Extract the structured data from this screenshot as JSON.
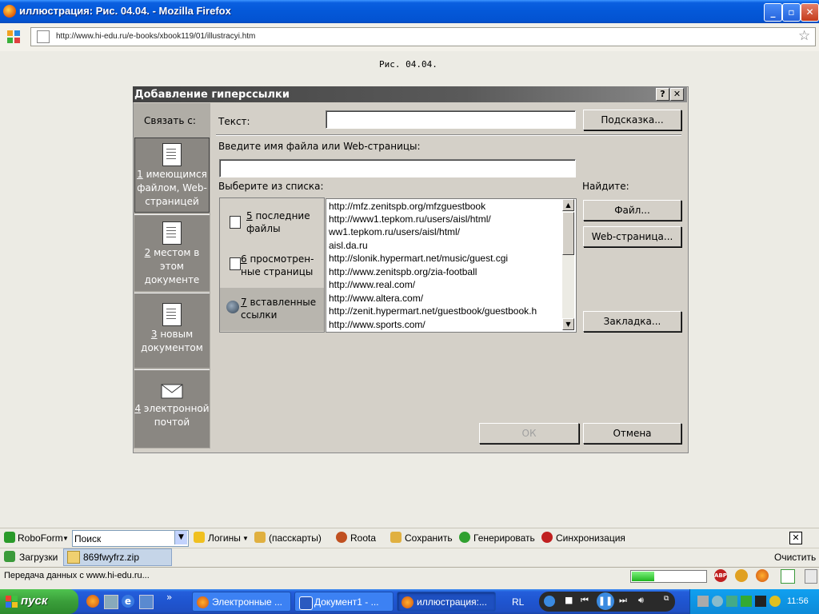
{
  "window": {
    "title": "иллюстрация: Рис. 04.04. - Mozilla Firefox",
    "min": "_",
    "max": "▫",
    "close": "✕"
  },
  "nav": {
    "url": "http://www.hi-edu.ru/e-books/xbook119/01/illustracyi.htm"
  },
  "page": {
    "caption": "Рис. 04.04."
  },
  "dialog": {
    "title": "Добавление гиперссылки",
    "help": "?",
    "close": "✕",
    "link_with": "Связать с:",
    "sidebar": [
      {
        "num": "1",
        "label1": " имеющимся",
        "label2": "файлом, Web-",
        "label3": "страницей"
      },
      {
        "num": "2",
        "label1": " местом в",
        "label2": "этом",
        "label3": "документе"
      },
      {
        "num": "3",
        "label1": " новым",
        "label2": "документом",
        "label3": ""
      },
      {
        "num": "4",
        "label1": " электронной",
        "label2": "почтой",
        "label3": ""
      }
    ],
    "text_label": "Текст:",
    "text_value": "",
    "hint_button": "Подсказка...",
    "file_label": "Введите имя файла или Web-страницы:",
    "file_value": "",
    "choose_label": "Выберите из списка:",
    "find_label": "Найдите:",
    "list_tabs": [
      {
        "num": "5",
        "line1": " последние",
        "line2": "файлы"
      },
      {
        "num": "6",
        "line1": " просмотрен-",
        "line2": "ные страницы"
      },
      {
        "num": "7",
        "line1": " вставленные",
        "line2": "ссылки"
      }
    ],
    "list_items": [
      "http://mfz.zenitspb.org/mfzguestbook",
      "http://www1.tepkom.ru/users/aisl/html/",
      "ww1.tepkom.ru/users/aisl/html/",
      "aisl.da.ru",
      "http://slonik.hypermart.net/music/guest.cgi",
      "http://www.zenitspb.org/zia-football",
      "http://www.real.com/",
      "http://www.altera.com/",
      "http://zenit.hypermart.net/guestbook/guestbook.h",
      "http://www.sports.com/"
    ],
    "file_button": "Файл...",
    "web_button": "Web-страница...",
    "bookmark_button": "Закладка...",
    "ok_button": "ОК",
    "cancel_button": "Отмена"
  },
  "robobar": {
    "roboform": "RoboForm",
    "search_value": "Поиск",
    "logins": "Логины",
    "passcards": "(пасскарты)",
    "roota": "Roota",
    "save": "Сохранить",
    "generate": "Генерировать",
    "sync": "Синхронизация"
  },
  "downloads": {
    "label": "Загрузки",
    "file": "869fwyfrz.zip",
    "clear": "Очистить"
  },
  "status": {
    "text": "Передача данных с www.hi-edu.ru...",
    "progress": 0.3
  },
  "taskbar": {
    "start": "пуск",
    "tasks": [
      "Электронные ...",
      "Документ1 - ...",
      "иллюстрация:..."
    ],
    "lang": "RL",
    "clock": "11:56"
  },
  "colors": {
    "titlebar": "#0458d8",
    "dialog_bg": "#d4d0c8",
    "sidebar_bg": "#b0ada6",
    "taskbar": "#245edb",
    "start": "#3a9e3a"
  }
}
